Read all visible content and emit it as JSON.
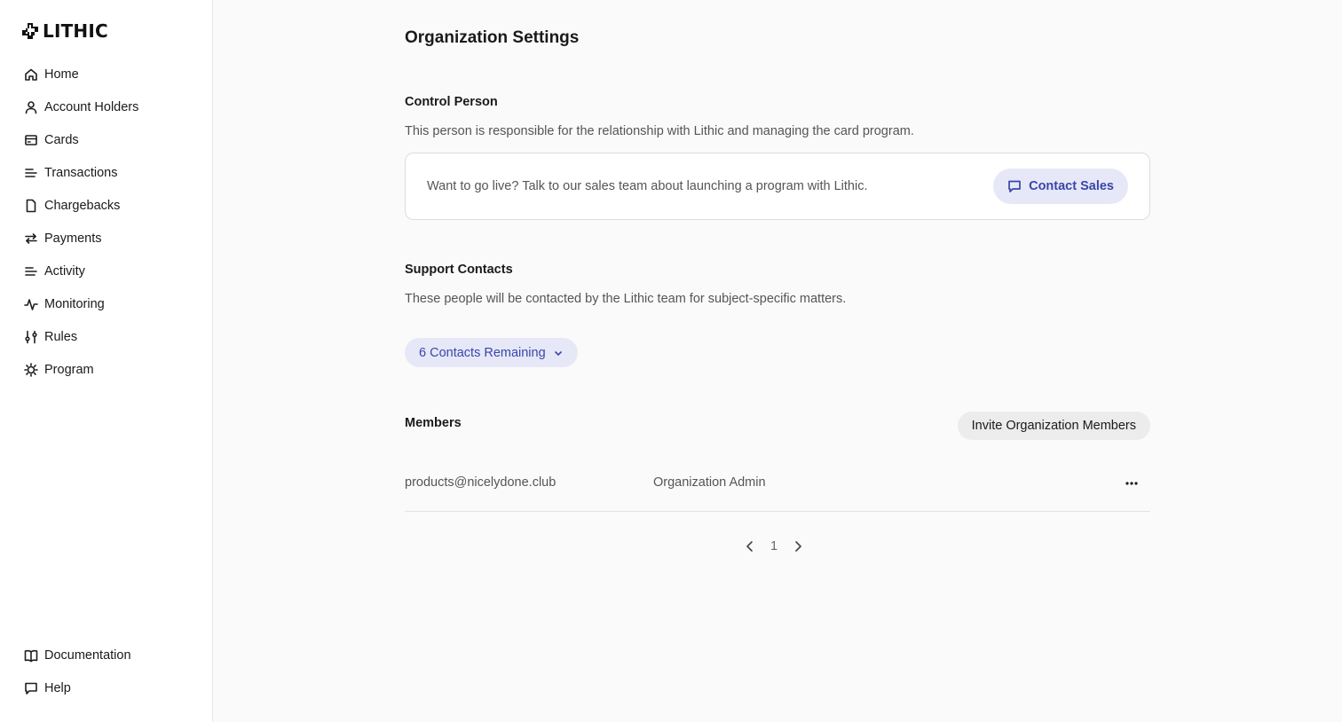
{
  "brand": {
    "name": "LITHIC",
    "logo_icon": "lithic-logo-icon"
  },
  "sidebar": {
    "items": [
      {
        "label": "Home",
        "icon": "home-icon"
      },
      {
        "label": "Account Holders",
        "icon": "user-icon"
      },
      {
        "label": "Cards",
        "icon": "card-icon"
      },
      {
        "label": "Transactions",
        "icon": "list-icon"
      },
      {
        "label": "Chargebacks",
        "icon": "document-icon"
      },
      {
        "label": "Payments",
        "icon": "transfer-icon"
      },
      {
        "label": "Activity",
        "icon": "list-icon"
      },
      {
        "label": "Monitoring",
        "icon": "pulse-icon"
      },
      {
        "label": "Rules",
        "icon": "sliders-icon"
      },
      {
        "label": "Program",
        "icon": "gear-icon"
      }
    ],
    "bottom_items": [
      {
        "label": "Documentation",
        "icon": "book-icon"
      },
      {
        "label": "Help",
        "icon": "chat-icon"
      }
    ]
  },
  "page": {
    "title": "Organization Settings",
    "control_person": {
      "title": "Control Person",
      "description": "This person is responsible for the relationship with Lithic and managing the card program.",
      "cta_text": "Want to go live? Talk to our sales team about launching a program with Lithic.",
      "contact_button": "Contact Sales"
    },
    "support_contacts": {
      "title": "Support Contacts",
      "description": "These people will be contacted by the Lithic team for subject-specific matters.",
      "dropdown_label": "6 Contacts Remaining"
    },
    "members": {
      "title": "Members",
      "invite_button": "Invite Organization Members",
      "rows": [
        {
          "email": "products@nicelydone.club",
          "role": "Organization Admin"
        }
      ]
    },
    "pagination": {
      "current_page": "1"
    }
  },
  "colors": {
    "accent": "#3a46a8",
    "accent_bg": "#e6e8f8",
    "background": "#fafafa",
    "sidebar_bg": "#ffffff"
  }
}
